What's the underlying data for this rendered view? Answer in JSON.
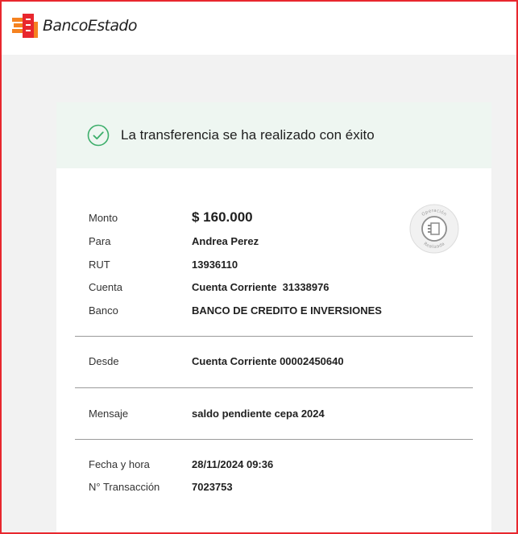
{
  "brand": {
    "name": "BancoEstado",
    "colors": {
      "orange": "#f58220",
      "red": "#e8272e",
      "success_green": "#3dae6b",
      "success_bg": "#eef6f1"
    }
  },
  "status": {
    "icon": "check-circle-icon",
    "message": "La transferencia se ha realizado con éxito"
  },
  "details": {
    "monto": {
      "label": "Monto",
      "value": "$ 160.000"
    },
    "para": {
      "label": "Para",
      "value": "Andrea Perez"
    },
    "rut": {
      "label": "RUT",
      "value": "13936110"
    },
    "cuenta": {
      "label": "Cuenta",
      "value": "Cuenta Corriente  31338976"
    },
    "banco": {
      "label": "Banco",
      "value": "BANCO DE CREDITO E INVERSIONES"
    }
  },
  "origin": {
    "desde": {
      "label": "Desde",
      "value": "Cuenta Corriente 00002450640"
    }
  },
  "message": {
    "mensaje": {
      "label": "Mensaje",
      "value": "saldo pendiente cepa 2024"
    }
  },
  "meta": {
    "fecha": {
      "label": "Fecha y hora",
      "value": "28/11/2024 09:36"
    },
    "transaccion": {
      "label": "N° Transacción",
      "value": "7023753"
    }
  },
  "stamp": {
    "icon": "operation-stamp-icon",
    "top_text": "Operación",
    "bottom_text": "Realizada"
  }
}
